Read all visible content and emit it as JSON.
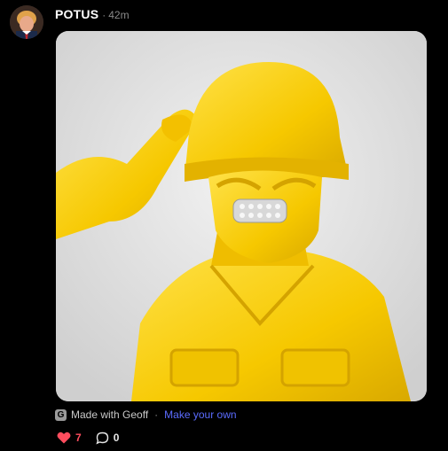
{
  "post": {
    "author": "POTUS",
    "separator": "·",
    "time": "42m"
  },
  "attribution": {
    "icon_letter": "G",
    "made_with": "Made with Geoff",
    "separator": "·",
    "make_your_own": "Make your own"
  },
  "actions": {
    "like_count": "7",
    "comment_count": "0",
    "like_color": "#ff4d5e",
    "link_color": "#5b6cff"
  },
  "icons": {
    "like": "heart-icon",
    "comment": "comment-bubble-icon",
    "attribution": "geoff-logo-icon"
  }
}
